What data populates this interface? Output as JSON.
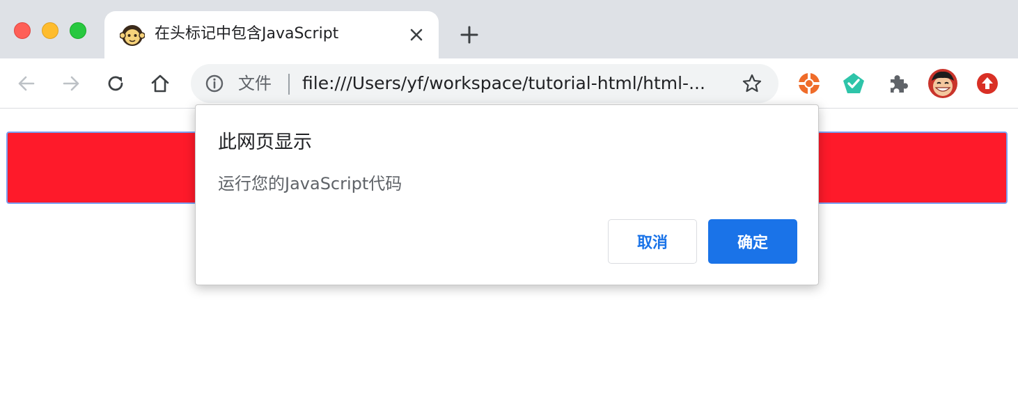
{
  "window": {
    "controls": [
      "close",
      "minimize",
      "maximize"
    ]
  },
  "tab": {
    "title": "在头标记中包含JavaScript",
    "favicon": "monkey-face-icon"
  },
  "toolbar": {
    "security_label": "文件",
    "url": "file:///Users/yf/workspace/tutorial-html/html-...",
    "icons": [
      "back-icon",
      "forward-icon",
      "reload-icon",
      "home-icon",
      "info-icon",
      "star-icon"
    ],
    "extensions": [
      "lifebuoy-extension-icon",
      "check-pentagon-extension-icon",
      "puzzle-extensions-icon",
      "profile-avatar",
      "upload-extension-icon"
    ]
  },
  "page": {
    "box_color": "#fe1a2a"
  },
  "dialog": {
    "title": "此网页显示",
    "message": "运行您的JavaScript代码",
    "cancel_label": "取消",
    "ok_label": "确定",
    "accent_color": "#1a73e8"
  }
}
